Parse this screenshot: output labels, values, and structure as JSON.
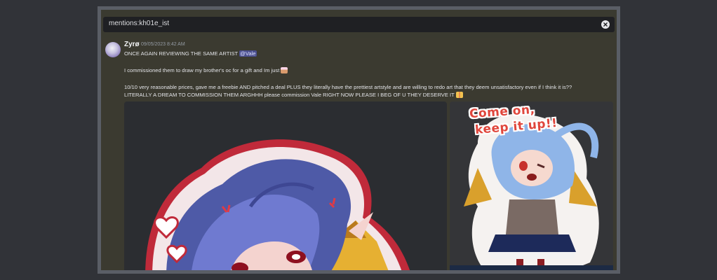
{
  "search": {
    "query": "mentions:kh01e_ist"
  },
  "message": {
    "author": "Zyrø",
    "timestamp": "09/05/2023 8:42 AM",
    "line1_text": "ONCE AGAIN REVIEWING THE SAME ARTIST ",
    "mention": "@Vale",
    "line2": "I commissioned them to draw my brother's oc for a gift and Im just",
    "line3": "10/10 very reasonable prices, gave me a freebie AND pitched a deal PLUS they literally have the prettiest artstyle and are willing to redo art that they deem unsatisfactory even if I think it is??",
    "line4": "LITERALLY A DREAM TO COMMISSION THEM ARGHHH please commission Vale RIGHT NOW PLEASE I BEG OF U THEY DESERVE IT",
    "sticker_text_line1": "Come on,",
    "sticker_text_line2": "keep it up!!"
  },
  "icons": {
    "clear": "close-circle-icon",
    "emoji1": "emoji-icon",
    "emoji2": "emoji-icon"
  },
  "colors": {
    "background": "#313338",
    "mention_bg": "#4c5090",
    "sticker_red": "#e0463c"
  }
}
